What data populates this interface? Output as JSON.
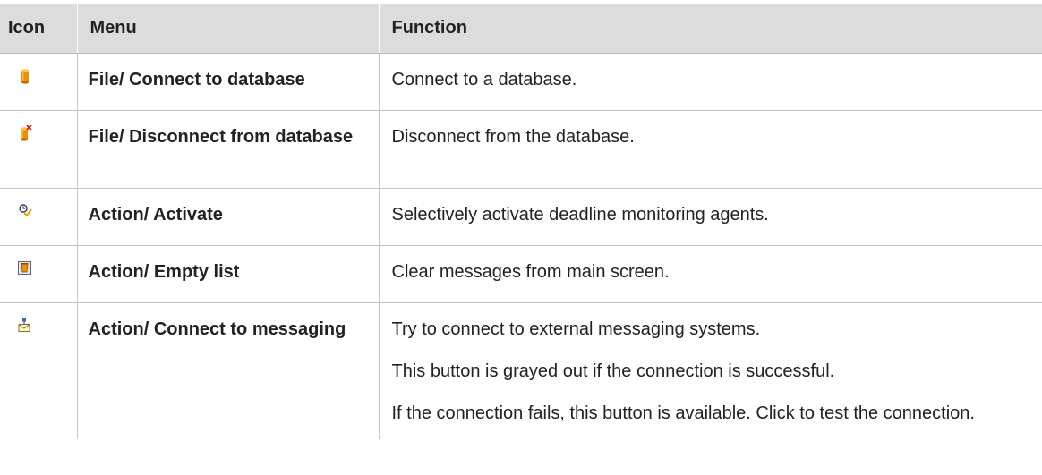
{
  "table": {
    "headers": {
      "icon": "Icon",
      "menu": "Menu",
      "function": "Function"
    },
    "rows": [
      {
        "icon": "database-connect-icon",
        "menu": "File/ Connect to database",
        "function": [
          "Connect to a database."
        ]
      },
      {
        "icon": "database-disconnect-icon",
        "menu": "File/ Disconnect from database",
        "function": [
          "Disconnect from the database."
        ]
      },
      {
        "icon": "activate-agents-icon",
        "menu": "Action/ Activate",
        "function": [
          "Selectively activate deadline monitoring agents."
        ]
      },
      {
        "icon": "empty-list-icon",
        "menu": "Action/ Empty list",
        "function": [
          "Clear messages from main screen."
        ]
      },
      {
        "icon": "connect-messaging-icon",
        "menu": "Action/ Connect to messaging",
        "function": [
          "Try to connect to external messaging systems.",
          "This button is grayed out if the connection is successful.",
          "If the connection fails, this button is available. Click to test the connection."
        ]
      }
    ]
  },
  "colors": {
    "header_bg": "#dcdcdc",
    "grid_line": "#c4c4c4",
    "db_orange": "#e8920c",
    "disconnect_red": "#d81818"
  }
}
